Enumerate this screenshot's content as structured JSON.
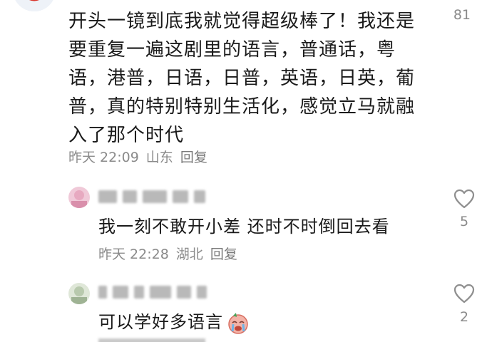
{
  "main_comment": {
    "text": "开头一镜到底我就觉得超级棒了！我还是要重复一遍这剧里的语言，普通话，粤语，港普，日语，日普，英语，日英，葡普，真的特别特别生活化，感觉立马就融入了那个时代",
    "time": "昨天 22:09",
    "location": "山东",
    "reply_label": "回复",
    "likes": "81"
  },
  "replies": [
    {
      "text": "我一刻不敢开小差 还时不时倒回去看",
      "time": "昨天 22:28",
      "location": "湖北",
      "reply_label": "回复",
      "likes": "5",
      "icon": "heart-outline-icon"
    },
    {
      "text": "可以学好多语言",
      "emoji": "crying-face-emoji",
      "likes": "2",
      "icon": "heart-outline-icon"
    }
  ],
  "colors": {
    "text": "#1a1a1a",
    "meta": "#8a8a8a",
    "icon": "#8f8f8f"
  }
}
